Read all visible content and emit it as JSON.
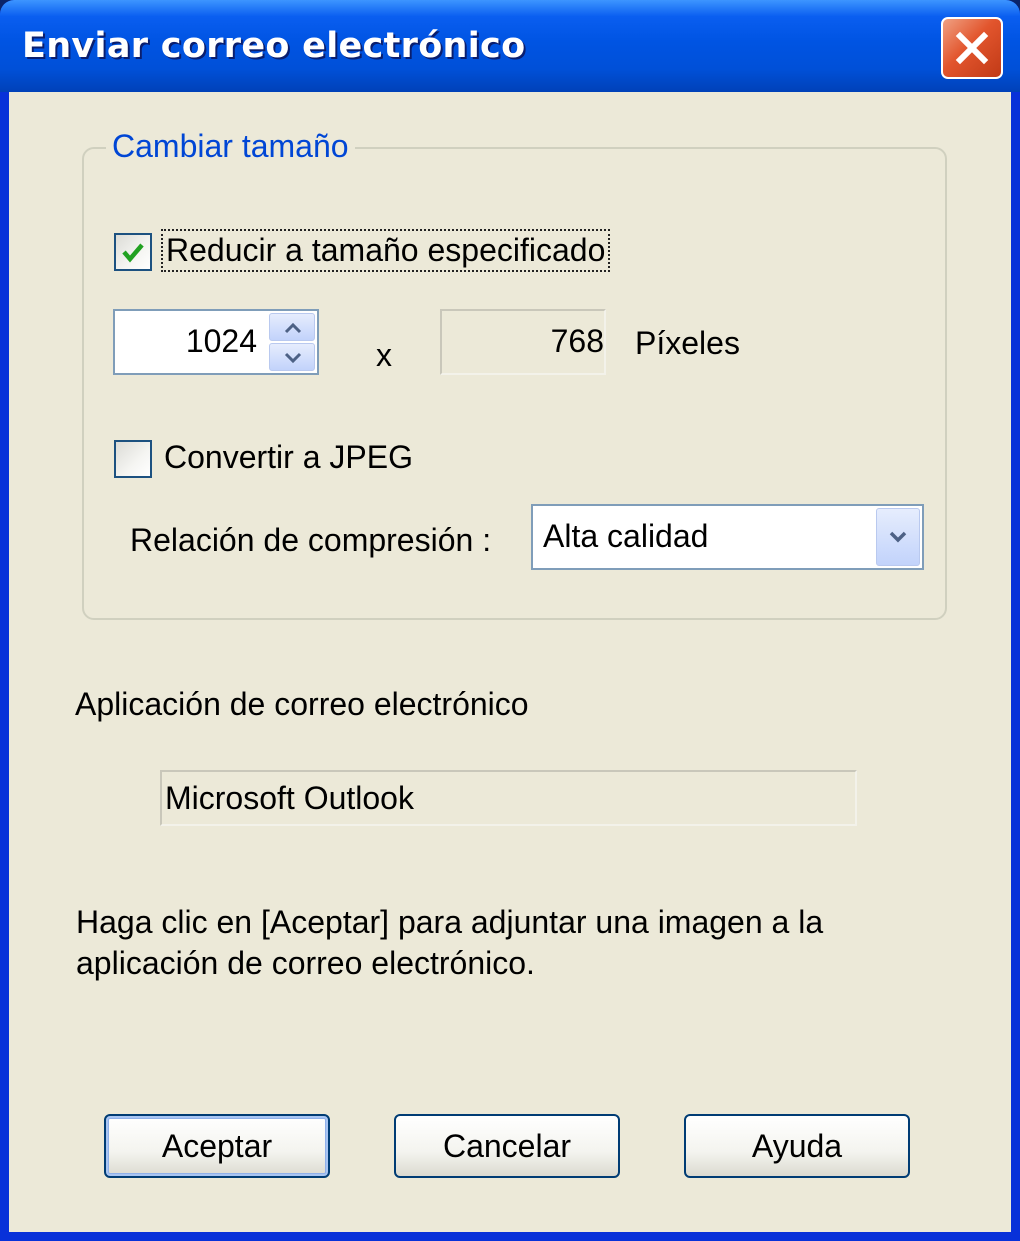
{
  "window": {
    "title": "Enviar correo electrónico"
  },
  "resize": {
    "group_label": "Cambiar tamaño",
    "reduce_checkbox": {
      "label": "Reducir a tamaño especificado",
      "checked": true
    },
    "width_value": "1024",
    "separator": "x",
    "height_value": "768",
    "unit_label": "Píxeles",
    "jpeg_checkbox": {
      "label": "Convertir a JPEG",
      "checked": false
    },
    "compression_label": "Relación de compresión :",
    "compression_value": "Alta calidad"
  },
  "mail": {
    "app_label": "Aplicación de correo electrónico",
    "app_value": "Microsoft Outlook"
  },
  "info_text": "Haga clic en [Aceptar] para adjuntar una imagen a la aplicación de correo electrónico.",
  "buttons": {
    "ok": "Aceptar",
    "cancel": "Cancelar",
    "help": "Ayuda"
  }
}
